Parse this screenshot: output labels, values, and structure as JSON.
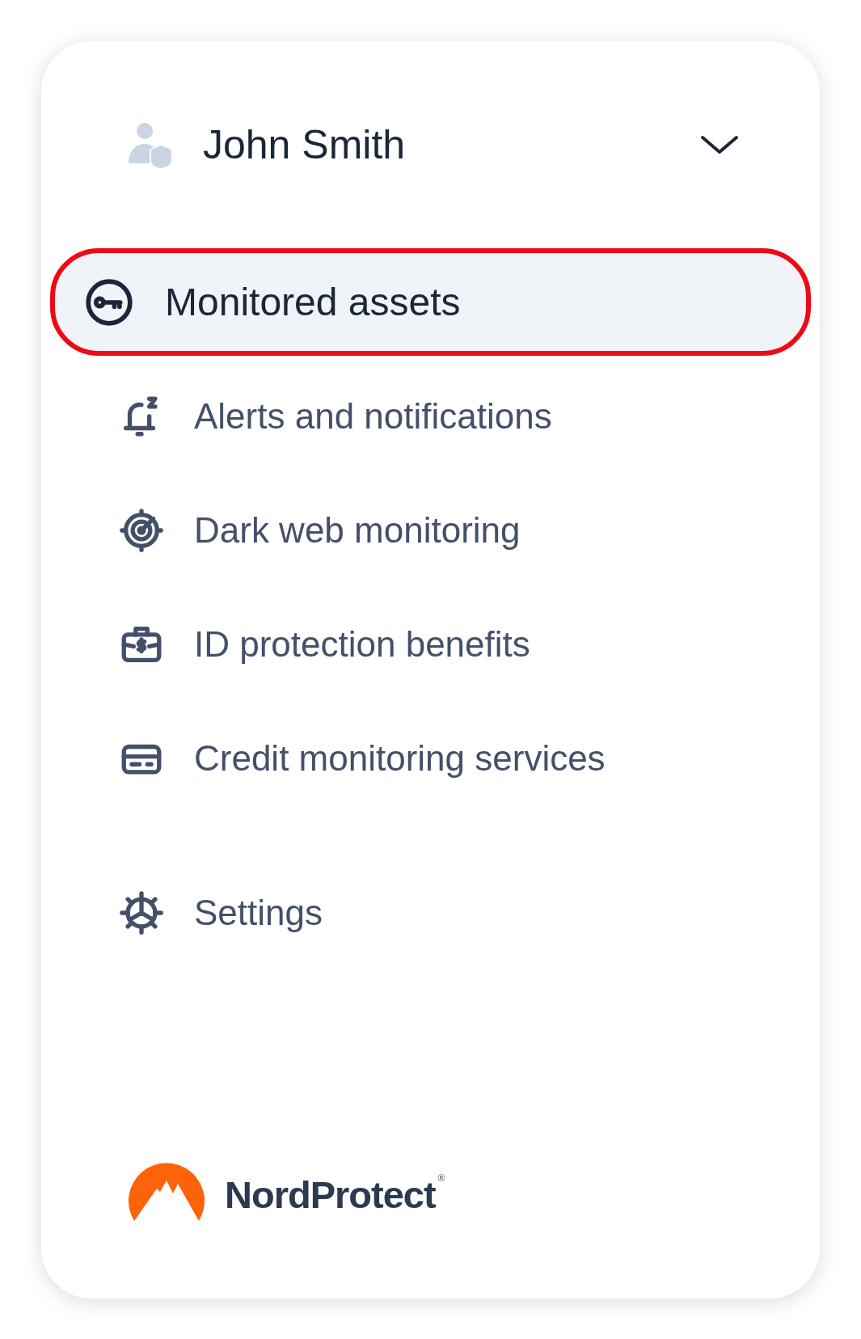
{
  "user": {
    "name": "John Smith",
    "expanded": false
  },
  "nav": [
    {
      "label": "Monitored assets",
      "selected": true
    },
    {
      "label": "Alerts and notifications",
      "selected": false
    },
    {
      "label": "Dark web monitoring",
      "selected": false
    },
    {
      "label": "ID protection benefits",
      "selected": false
    },
    {
      "label": "Credit monitoring services",
      "selected": false
    }
  ],
  "settings": {
    "label": "Settings",
    "selected": false
  },
  "brand": {
    "name": "NordProtect",
    "mark": "®"
  }
}
